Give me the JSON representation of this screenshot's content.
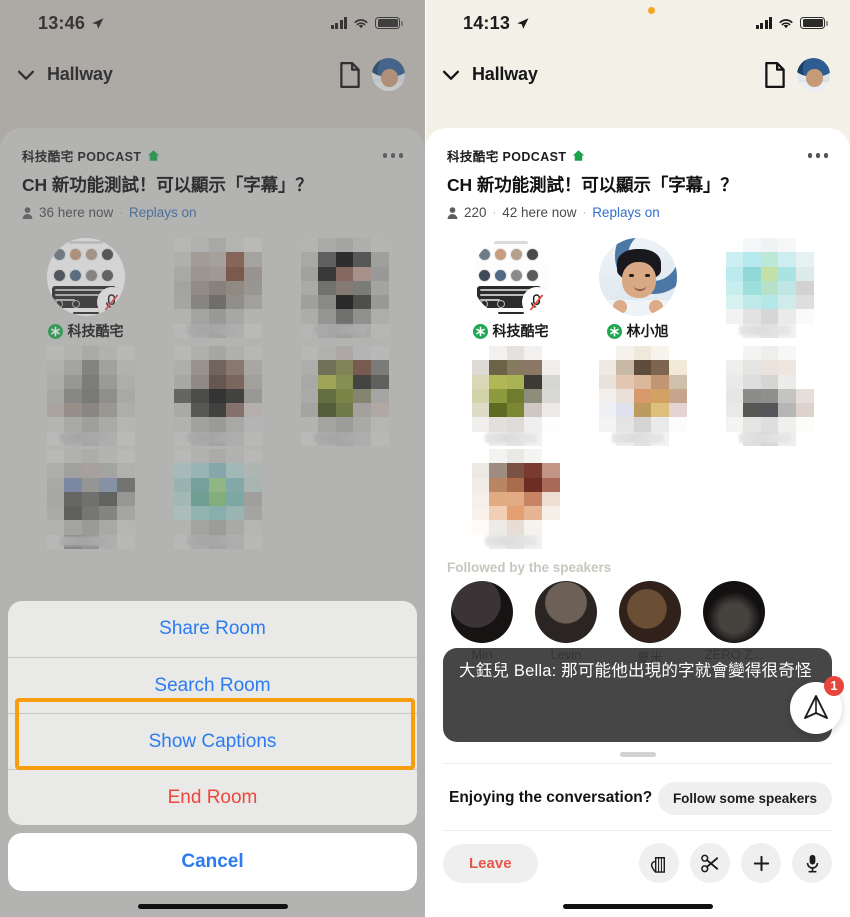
{
  "left": {
    "status": {
      "time": "13:46",
      "location_icon": "location-arrow-icon",
      "signal_icon": "cellular-bars-icon",
      "wifi_icon": "wifi-icon",
      "battery_icon": "battery-full-icon"
    },
    "header": {
      "chevron_icon": "chevron-down-icon",
      "title": "Hallway",
      "doc_icon": "document-icon",
      "avatar": "user-avatar"
    },
    "room": {
      "club": "科技酷宅 PODCAST",
      "house_icon": "house-icon",
      "more_icon": "more-options-icon",
      "title": "CH 新功能測試！可以顯示「字幕」？",
      "people_icon": "person-icon",
      "here_now": "36 here now",
      "separator": "·",
      "replays": "Replays on"
    },
    "members": [
      {
        "name": "科技酷宅",
        "type": "club-thumb",
        "badge": "green-asterisk-icon",
        "muted": true
      },
      {
        "name": "",
        "type": "mosaic"
      },
      {
        "name": "",
        "type": "mosaic"
      },
      {
        "name": "",
        "type": "mosaic"
      },
      {
        "name": "",
        "type": "mosaic"
      },
      {
        "name": "",
        "type": "mosaic"
      },
      {
        "name": "",
        "type": "mosaic"
      },
      {
        "name": "",
        "type": "mosaic"
      }
    ],
    "action_sheet": {
      "items": [
        {
          "label": "Share Room",
          "style": "default"
        },
        {
          "label": "Search Room",
          "style": "default"
        },
        {
          "label": "Show Captions",
          "style": "default",
          "highlighted": true
        },
        {
          "label": "End Room",
          "style": "destructive"
        }
      ],
      "cancel": "Cancel"
    },
    "highlight_color": "#f79d10",
    "bg_color": "#c5c1b9"
  },
  "right": {
    "status": {
      "time": "14:13",
      "location_icon": "location-arrow-icon",
      "recording_dot": "recording-indicator",
      "signal_icon": "cellular-bars-icon",
      "wifi_icon": "wifi-icon",
      "battery_icon": "battery-full-icon"
    },
    "header": {
      "chevron_icon": "chevron-down-icon",
      "title": "Hallway",
      "doc_icon": "document-icon",
      "avatar": "user-avatar"
    },
    "room": {
      "club": "科技酷宅 PODCAST",
      "house_icon": "house-icon",
      "more_icon": "more-options-icon",
      "title": "CH 新功能測試！可以顯示「字幕」？",
      "people_icon": "person-icon",
      "total": "220",
      "here_now": "42 here now",
      "separator": "·",
      "replays": "Replays on"
    },
    "members": [
      {
        "name": "科技酷宅",
        "type": "club-thumb",
        "badge": "green-asterisk-icon",
        "muted": true
      },
      {
        "name": "林小旭",
        "type": "photo",
        "badge": "green-asterisk-icon"
      },
      {
        "name": "",
        "type": "mosaic"
      },
      {
        "name": "",
        "type": "mosaic"
      },
      {
        "name": "",
        "type": "mosaic"
      },
      {
        "name": "",
        "type": "mosaic"
      },
      {
        "name": "",
        "type": "mosaic"
      }
    ],
    "followed_label": "Followed by the speakers",
    "followed": [
      {
        "name": "Min"
      },
      {
        "name": "Levin"
      },
      {
        "name": "夏米"
      },
      {
        "name": "ZERO Z..."
      }
    ],
    "caption": {
      "text": "大鈺兒 Bella: 那可能他出現的字就會變得很奇怪"
    },
    "raise_hand": {
      "icon": "raise-hand-paper-plane-icon",
      "badge_count": "1",
      "badge_color": "#e8453c"
    },
    "cta": {
      "text": "Enjoying the conversation?",
      "button": "Follow some speakers"
    },
    "toolbar": {
      "leave": "Leave",
      "leave_color": "#e7564b",
      "buttons": [
        {
          "icon": "raise-hand-icon"
        },
        {
          "icon": "scissors-clip-icon"
        },
        {
          "icon": "plus-add-people-icon"
        },
        {
          "icon": "microphone-icon"
        }
      ]
    },
    "bg_color": "#f3f0e7"
  }
}
